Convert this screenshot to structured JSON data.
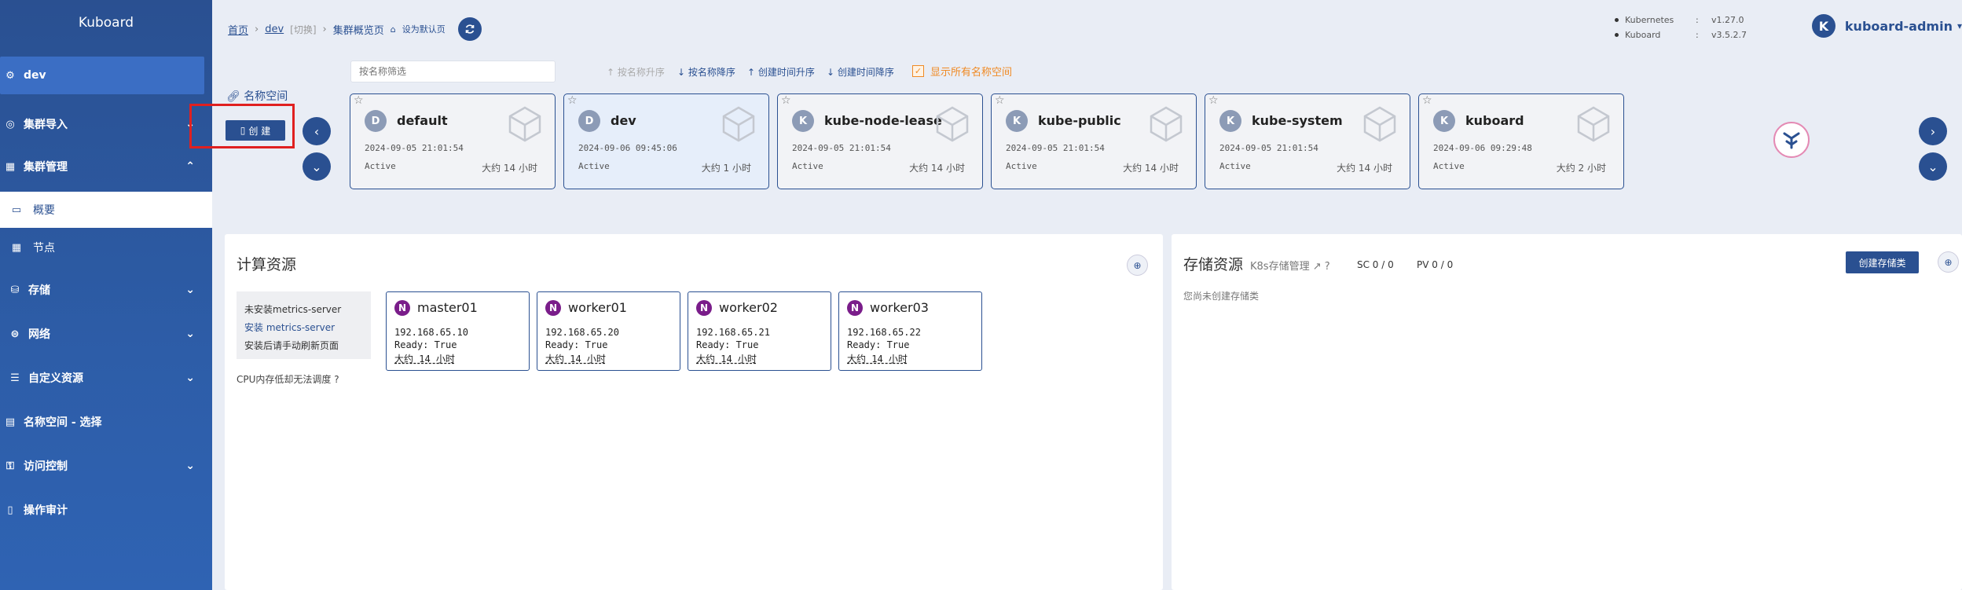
{
  "sidebar": {
    "brand": "Kuboard",
    "cluster": "dev",
    "items": [
      {
        "label": "集群导入",
        "icon": "import-icon"
      },
      {
        "label": "集群管理",
        "icon": "cluster-icon"
      },
      {
        "label": "概要",
        "icon": "overview-icon"
      },
      {
        "label": "节点",
        "icon": "node-icon"
      },
      {
        "label": "存储",
        "icon": "storage-icon"
      },
      {
        "label": "网络",
        "icon": "network-icon"
      },
      {
        "label": "自定义资源",
        "icon": "crd-icon"
      },
      {
        "label": "名称空间 - 选择",
        "icon": "namespace-icon"
      },
      {
        "label": "访问控制",
        "icon": "access-icon"
      },
      {
        "label": "操作审计",
        "icon": "audit-icon"
      }
    ]
  },
  "header": {
    "breadcrumb_home": "首页",
    "breadcrumb_cluster": "dev",
    "breadcrumb_switch": "[切换]",
    "breadcrumb_page": "集群概览页",
    "set_default": "设为默认页",
    "versions": [
      {
        "name": "Kubernetes",
        "value": "v1.27.0"
      },
      {
        "name": "Kuboard",
        "value": "v3.5.2.7"
      }
    ],
    "user_initial": "K",
    "user_name": "kuboard-admin"
  },
  "namespace_bar": {
    "search_placeholder": "按名称筛选",
    "sort_options": [
      "按名称升序",
      "按名称降序",
      "创建时间升序",
      "创建时间降序"
    ],
    "show_all_label": "显示所有名称空间",
    "label": "名称空间",
    "create_label": "创 建"
  },
  "namespaces": [
    {
      "initial": "D",
      "name": "default",
      "created": "2024-09-05 21:01:54",
      "status": "Active",
      "age": "大约 14 小时"
    },
    {
      "initial": "D",
      "name": "dev",
      "created": "2024-09-06 09:45:06",
      "status": "Active",
      "age": "大约 1 小时"
    },
    {
      "initial": "K",
      "name": "kube-node-lease",
      "created": "2024-09-05 21:01:54",
      "status": "Active",
      "age": "大约 14 小时"
    },
    {
      "initial": "K",
      "name": "kube-public",
      "created": "2024-09-05 21:01:54",
      "status": "Active",
      "age": "大约 14 小时"
    },
    {
      "initial": "K",
      "name": "kube-system",
      "created": "2024-09-05 21:01:54",
      "status": "Active",
      "age": "大约 14 小时"
    },
    {
      "initial": "K",
      "name": "kuboard",
      "created": "2024-09-06 09:29:48",
      "status": "Active",
      "age": "大约 2 小时"
    }
  ],
  "compute": {
    "title": "计算资源",
    "metrics_line1": "未安装metrics-server",
    "metrics_line2": "安装 metrics-server",
    "metrics_line3": "安装后请手动刷新页面",
    "cpu_note": "CPU内存低却无法调度",
    "nodes": [
      {
        "initial": "N",
        "name": "master01",
        "ip": "192.168.65.10",
        "ready": "Ready: True",
        "age": "大约 14 小时"
      },
      {
        "initial": "N",
        "name": "worker01",
        "ip": "192.168.65.20",
        "ready": "Ready: True",
        "age": "大约 14 小时"
      },
      {
        "initial": "N",
        "name": "worker02",
        "ip": "192.168.65.21",
        "ready": "Ready: True",
        "age": "大约 14 小时"
      },
      {
        "initial": "N",
        "name": "worker03",
        "ip": "192.168.65.22",
        "ready": "Ready: True",
        "age": "大约 14 小时"
      }
    ]
  },
  "storage": {
    "title": "存储资源",
    "subtitle": "K8s存储管理",
    "sc": "SC 0 / 0",
    "pv": "PV 0 / 0",
    "create_label": "创建存储类",
    "empty": "您尚未创建存储类"
  },
  "colors": {
    "primary": "#2a5091",
    "accent": "#f08a24",
    "highlight": "#e02020"
  }
}
